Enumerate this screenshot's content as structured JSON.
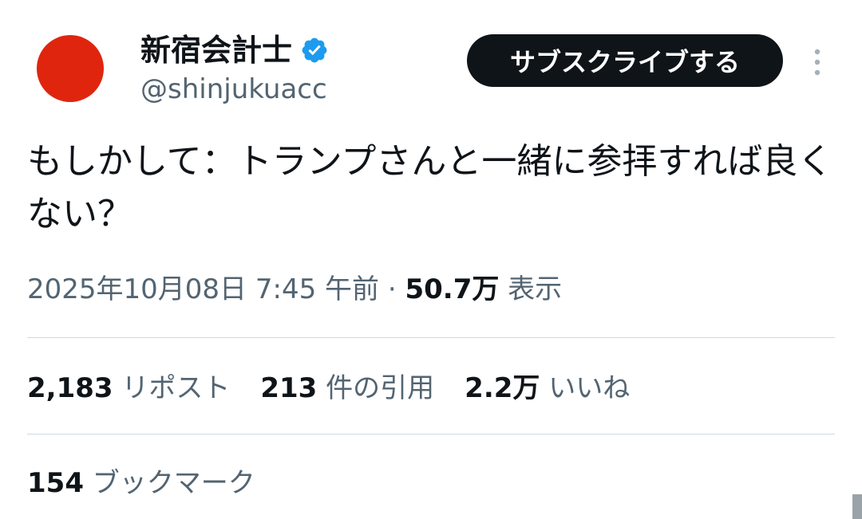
{
  "author": {
    "display_name": "新宿会計士",
    "handle": "@shinjukuacc",
    "avatar_color": "#e0250f",
    "verified_color": "#1d9bf0"
  },
  "actions": {
    "subscribe_label": "サブスクライブする",
    "more_icon": "more-vertical-icon"
  },
  "tweet": {
    "text": "もしかして：トランプさんと一緒に参拝すれば良くない？",
    "timestamp": "2025年10月08日 7:45 午前",
    "separator": " · ",
    "views_count": "50.7万",
    "views_label": "表示"
  },
  "stats": {
    "reposts": {
      "count": "2,183",
      "label": "リポスト"
    },
    "quotes": {
      "count": "213",
      "label": "件の引用"
    },
    "likes": {
      "count": "2.2万",
      "label": "いいね"
    },
    "bookmarks": {
      "count": "154",
      "label": "ブックマーク"
    }
  }
}
